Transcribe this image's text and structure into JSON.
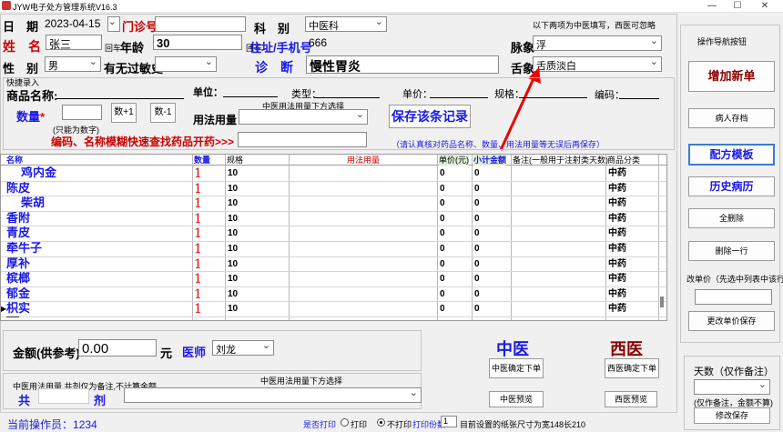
{
  "window": {
    "title": "JYW电子处方管理系统V16.3",
    "minimize": "—",
    "maximize": "☐",
    "close": "✕"
  },
  "header": {
    "date_label": "日　期",
    "date_value": "2023-04-15",
    "outpatient_label": "门诊号",
    "dept_label": "科　别",
    "dept_value": "中医科",
    "tcm_hint": "以下两项为中医填写，西医可忽略",
    "name_label": "姓　名",
    "name_value": "张三",
    "enter1": "回车",
    "age_label": "年龄",
    "age_value": "30",
    "enter2": "回车",
    "address_label": "住址/手机号",
    "address_value": "666",
    "pulse_label": "脉象",
    "pulse_value": "浮",
    "sex_label": "性　别",
    "sex_value": "男",
    "allergy_label": "有无过敏史",
    "allergy_value": "",
    "diagnosis_label": "诊　断",
    "diagnosis_value": "慢性胃炎",
    "tongue_label": "舌象",
    "tongue_value": "舌质淡白"
  },
  "quick": {
    "title": "快捷录入",
    "product_label": "商品名称:",
    "unit_label": "单位：",
    "type_label": "类型：",
    "price_label": "单价：",
    "spec_label": "规格：",
    "code_label": "编码：",
    "qty_label": "数量",
    "qty_star": "*",
    "qty_hint": "(只能为数字)",
    "plus": "数+1",
    "minus": "数-1",
    "usage_hint": "中医用法用量下方选择",
    "usage_label": "用法用量",
    "save_btn": "保存该条记录",
    "search_label": "编码、名称模糊快速查找药品开药>>>",
    "check_hint": "（请认真核对药品名称、数量、用法用量等无误后再保存）"
  },
  "table": {
    "headers": [
      "名称",
      "数量",
      "规格",
      "用法用量",
      "单价(元)",
      "小计金额",
      "备注(一般用于注射类天数)",
      "商品分类"
    ],
    "rows": [
      {
        "name": "鸡内金",
        "qty": "1",
        "spec": "10",
        "price": "0",
        "subtotal": "0",
        "cat": "中药"
      },
      {
        "name": "陈皮",
        "qty": "1",
        "spec": "10",
        "price": "0",
        "subtotal": "0",
        "cat": "中药"
      },
      {
        "name": "柴胡",
        "qty": "1",
        "spec": "10",
        "price": "0",
        "subtotal": "0",
        "cat": "中药"
      },
      {
        "name": "香附",
        "qty": "1",
        "spec": "10",
        "price": "0",
        "subtotal": "0",
        "cat": "中药"
      },
      {
        "name": "青皮",
        "qty": "1",
        "spec": "10",
        "price": "0",
        "subtotal": "0",
        "cat": "中药"
      },
      {
        "name": "牵牛子",
        "qty": "1",
        "spec": "10",
        "price": "0",
        "subtotal": "0",
        "cat": "中药"
      },
      {
        "name": "厚补",
        "qty": "1",
        "spec": "10",
        "price": "0",
        "subtotal": "0",
        "cat": "中药"
      },
      {
        "name": "槟榔",
        "qty": "1",
        "spec": "10",
        "price": "0",
        "subtotal": "0",
        "cat": "中药"
      },
      {
        "name": "郁金",
        "qty": "1",
        "spec": "10",
        "price": "0",
        "subtotal": "0",
        "cat": "中药"
      },
      {
        "name": "枳实",
        "qty": "1",
        "spec": "10",
        "price": "0",
        "subtotal": "0",
        "cat": "中药"
      }
    ]
  },
  "bottom": {
    "amount_label": "金额(供参考)",
    "amount_value": "0.00",
    "yuan": "元",
    "doctor_label": "医师",
    "doctor_value": "刘龙",
    "tcm_usage_hint1": "中医用法用量,共剂仅为备注,不计算金额",
    "tcm_usage_hint2": "中医用法用量下方选择",
    "total_label": "共",
    "dose_label": "剂",
    "tcm_title": "中医",
    "tcm_confirm": "中医确定下单",
    "tcm_preview": "中医预览",
    "wm_title": "西医",
    "wm_confirm": "西医确定下单",
    "wm_preview": "西医预览"
  },
  "status": {
    "operator_label": "当前操作员：",
    "operator_value": "1234",
    "print_label": "是否打印",
    "print_opt": "打印",
    "noprint_opt": "不打印",
    "print_copies_label": "打印份数",
    "print_copies": "1",
    "paper_info": "目前设置的纸张尺寸为宽148长210"
  },
  "side": {
    "title": "操作导航按钮",
    "add_new": "增加新单",
    "patient_archive": "病人存档",
    "template": "配方模板",
    "history": "历史病历",
    "delete_all": "全删除",
    "delete_row": "删除一行",
    "change_price_hint": "改单价（先选中列表中该行）",
    "save_price": "更改单价保存",
    "days_label": "天数（仅作备注）",
    "days_hint": "(仅作备注，金额不算)",
    "modify_save": "修改保存"
  }
}
